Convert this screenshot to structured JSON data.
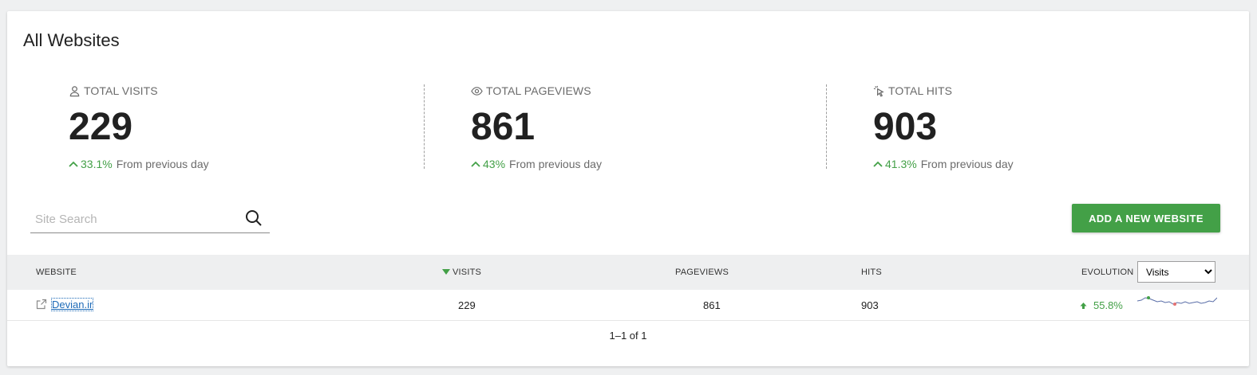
{
  "header": {
    "title": "All Websites"
  },
  "kpis": [
    {
      "label": "TOTAL VISITS",
      "icon": "person-icon",
      "value": "229",
      "change": "33.1%",
      "change_text": "From previous day"
    },
    {
      "label": "TOTAL PAGEVIEWS",
      "icon": "eye-icon",
      "value": "861",
      "change": "43%",
      "change_text": "From previous day"
    },
    {
      "label": "TOTAL HITS",
      "icon": "cursor-click-icon",
      "value": "903",
      "change": "41.3%",
      "change_text": "From previous day"
    }
  ],
  "search": {
    "placeholder": "Site Search",
    "value": ""
  },
  "toolbar": {
    "add_label": "ADD A NEW WEBSITE"
  },
  "table": {
    "columns": {
      "website": "WEBSITE",
      "visits": "VISITS",
      "pageviews": "PAGEVIEWS",
      "hits": "HITS",
      "evolution": "EVOLUTION"
    },
    "evolution_metric": "Visits",
    "evolution_options": [
      "Visits"
    ],
    "rows": [
      {
        "website": "Devian.ir",
        "visits": "229",
        "pageviews": "861",
        "hits": "903",
        "evolution": "55.8%"
      }
    ]
  },
  "pagination": {
    "text": "1–1 of 1"
  },
  "colors": {
    "accent": "#43a047",
    "link": "#1e6bb8",
    "spark_line": "#5a6ea8",
    "spark_high": "#43a047",
    "spark_low": "#e57373"
  }
}
